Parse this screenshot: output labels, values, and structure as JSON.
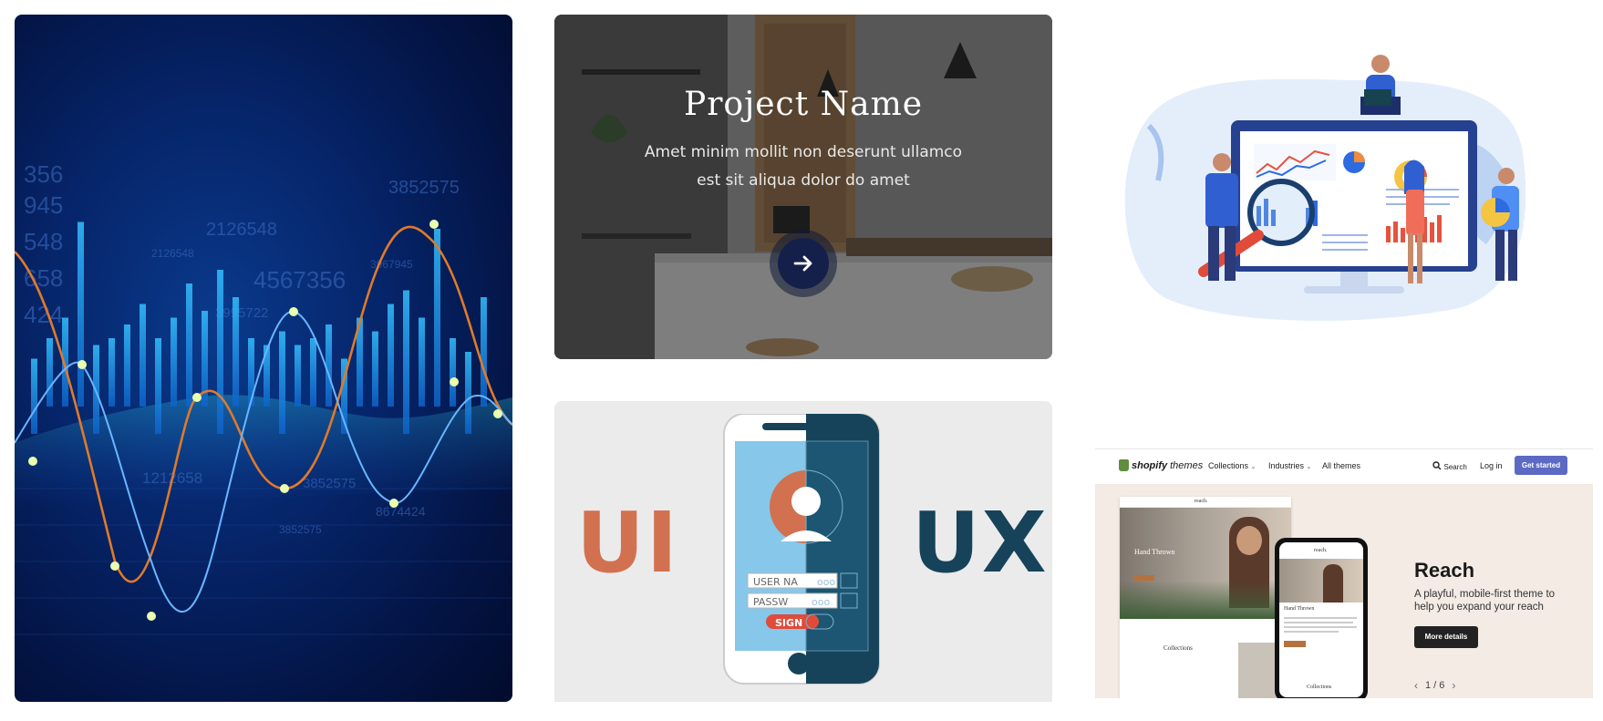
{
  "project_card": {
    "title": "Project Name",
    "description_line1": "Amet minim mollit non deserunt ullamco",
    "description_line2": "est sit aliqua dolor do amet",
    "arrow_icon": "arrow-right-icon"
  },
  "finance_card": {
    "numbers": [
      "3852575",
      "2126548",
      "4567356",
      "3995722",
      "3967945",
      "1212658",
      "3852575",
      "8674424",
      "3852575",
      "2126548",
      "548",
      "658",
      "424",
      "356",
      "945"
    ]
  },
  "uiux_card": {
    "left_text": "UI",
    "right_text": "UX",
    "field_user": "USER NA",
    "field_pass": "PASSW",
    "field_sign": "SIGN"
  },
  "shopify_card": {
    "logo_bold": "shopify",
    "logo_light": "themes",
    "nav": {
      "collections": "Collections",
      "industries": "Industries",
      "all_themes": "All themes",
      "search": "Search",
      "login": "Log in",
      "get_started": "Get started"
    },
    "hero": {
      "title": "Reach",
      "description": "A playful, mobile-first theme to help you expand your reach",
      "button": "More details",
      "pager": "1 / 6"
    },
    "desktop_preview": {
      "brand": "reach.",
      "hero_text": "Hand Thrown",
      "section": "Collections"
    },
    "phone_preview": {
      "brand": "reach.",
      "heading": "Hand Thrown",
      "section": "Collections"
    }
  },
  "colors": {
    "accent_purple": "#5c6ac4",
    "ui_orange": "#d2714f",
    "ux_teal": "#16435a",
    "finance_orange": "#e07a2a",
    "finance_cyan": "#1ea7f0"
  }
}
